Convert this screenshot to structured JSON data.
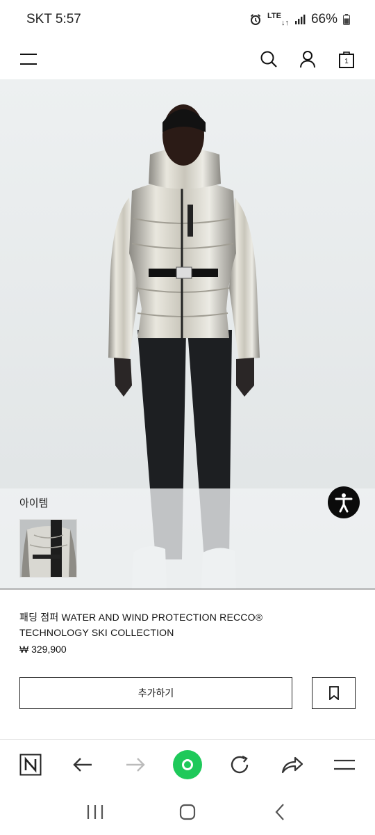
{
  "status_bar": {
    "carrier_time": "SKT 5:57",
    "network": "LTE",
    "battery": "66%",
    "icons": [
      "alarm-icon",
      "lte-icon",
      "signal-icon",
      "battery-icon"
    ]
  },
  "header": {
    "icons": [
      "menu-icon",
      "search-icon",
      "user-icon",
      "bag-icon"
    ],
    "cart_count": "1"
  },
  "items_section": {
    "title": "아이템"
  },
  "product": {
    "name": "패딩 점퍼 WATER AND WIND PROTECTION RECCO® TECHNOLOGY SKI COLLECTION",
    "price": "₩ 329,900",
    "add_button_label": "추가하기"
  },
  "browser_toolbar": {
    "buttons": [
      "naver-home-icon",
      "back-icon",
      "forward-icon",
      "green-dot-icon",
      "reload-icon",
      "share-icon",
      "more-menu-icon"
    ]
  },
  "system_nav": {
    "buttons": [
      "recents-icon",
      "home-icon",
      "back-nav-icon"
    ]
  },
  "colors": {
    "hero_background": "#e6e9ea",
    "accent_green": "#1ec95a",
    "text": "#111111"
  }
}
